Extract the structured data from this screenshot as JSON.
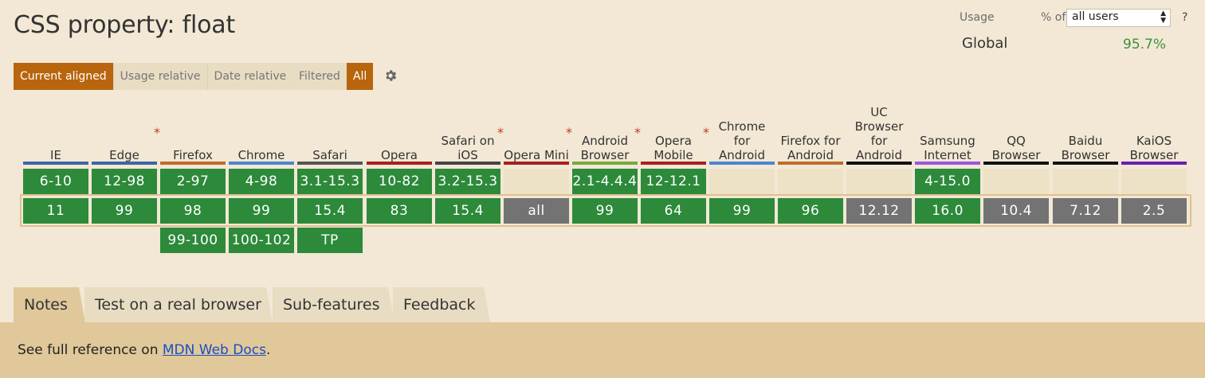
{
  "page_title": "CSS property: float",
  "usage": {
    "label": "Usage",
    "pct_of_label": "% of",
    "users_select_value": "all users",
    "help": "?",
    "global_label": "Global",
    "global_value": "95.7%"
  },
  "view_buttons": [
    "Current aligned",
    "Usage relative",
    "Date relative"
  ],
  "filter_buttons": [
    "Filtered",
    "All"
  ],
  "browsers": [
    {
      "name": "IE",
      "color": "#3d66a8",
      "star": false,
      "rows": [
        "6-10",
        "11",
        ""
      ],
      "state": [
        "green",
        "green",
        "none"
      ]
    },
    {
      "name": "Edge",
      "color": "#3d66a8",
      "star": true,
      "rows": [
        "12-98",
        "99",
        ""
      ],
      "state": [
        "green",
        "green",
        "none"
      ]
    },
    {
      "name": "Firefox",
      "color": "#c26a2c",
      "star": false,
      "rows": [
        "2-97",
        "98",
        "99-100"
      ],
      "state": [
        "green",
        "green",
        "green"
      ]
    },
    {
      "name": "Chrome",
      "color": "#4a86cf",
      "star": false,
      "rows": [
        "4-98",
        "99",
        "100-102"
      ],
      "state": [
        "green",
        "green",
        "green"
      ]
    },
    {
      "name": "Safari",
      "color": "#555555",
      "star": false,
      "rows": [
        "3.1-15.3",
        "15.4",
        "TP"
      ],
      "state": [
        "green",
        "green",
        "green"
      ]
    },
    {
      "name": "Opera",
      "color": "#a82020",
      "star": false,
      "rows": [
        "10-82",
        "83",
        ""
      ],
      "state": [
        "green",
        "green",
        "none"
      ]
    },
    {
      "name": "Safari on iOS",
      "color": "#444444",
      "star": true,
      "rows": [
        "3.2-15.3",
        "15.4",
        ""
      ],
      "state": [
        "green",
        "green",
        "none"
      ]
    },
    {
      "name": "Opera Mini",
      "color": "#a82020",
      "star": true,
      "rows": [
        "",
        "all",
        ""
      ],
      "state": [
        "empty",
        "gray",
        "none"
      ]
    },
    {
      "name": "Android Browser",
      "color": "#7aa83a",
      "star": true,
      "rows": [
        "2.1-4.4.4",
        "99",
        ""
      ],
      "state": [
        "green",
        "green",
        "none"
      ]
    },
    {
      "name": "Opera Mobile",
      "color": "#a82020",
      "star": true,
      "rows": [
        "12-12.1",
        "64",
        ""
      ],
      "state": [
        "green",
        "green",
        "none"
      ]
    },
    {
      "name": "Chrome for Android",
      "color": "#4a86cf",
      "star": false,
      "rows": [
        "",
        "99",
        ""
      ],
      "state": [
        "empty",
        "green",
        "none"
      ]
    },
    {
      "name": "Firefox for Android",
      "color": "#c26a2c",
      "star": false,
      "rows": [
        "",
        "96",
        ""
      ],
      "state": [
        "empty",
        "green",
        "none"
      ]
    },
    {
      "name": "UC Browser for Android",
      "color": "#111111",
      "star": false,
      "rows": [
        "",
        "12.12",
        ""
      ],
      "state": [
        "empty",
        "gray",
        "none"
      ]
    },
    {
      "name": "Samsung Internet",
      "color": "#9b55e0",
      "star": false,
      "rows": [
        "4-15.0",
        "16.0",
        ""
      ],
      "state": [
        "green",
        "green",
        "none"
      ]
    },
    {
      "name": "QQ Browser",
      "color": "#111111",
      "star": false,
      "rows": [
        "",
        "10.4",
        ""
      ],
      "state": [
        "empty",
        "gray",
        "none"
      ]
    },
    {
      "name": "Baidu Browser",
      "color": "#111111",
      "star": false,
      "rows": [
        "",
        "7.12",
        ""
      ],
      "state": [
        "empty",
        "gray",
        "none"
      ]
    },
    {
      "name": "KaiOS Browser",
      "color": "#6a1fb0",
      "star": false,
      "rows": [
        "",
        "2.5",
        ""
      ],
      "state": [
        "empty",
        "gray",
        "none"
      ]
    }
  ],
  "tabs": [
    "Notes",
    "Test on a real browser",
    "Sub-features",
    "Feedback"
  ],
  "notes": {
    "prefix": "See full reference on ",
    "link_text": "MDN Web Docs",
    "suffix": "."
  }
}
